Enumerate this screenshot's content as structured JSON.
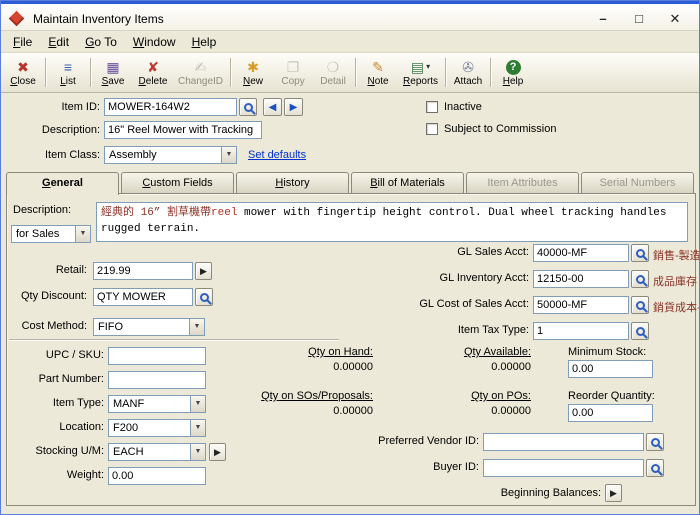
{
  "window": {
    "title": "Maintain Inventory Items"
  },
  "titlebar_controls": {
    "minimize": "–",
    "maximize": "□",
    "close": "✕"
  },
  "menu": {
    "items": [
      "File",
      "Edit",
      "Go To",
      "Window",
      "Help"
    ]
  },
  "toolbar": {
    "buttons": [
      {
        "label": "Close",
        "glyph": "✖"
      },
      {
        "label": "List",
        "glyph": "≡"
      },
      {
        "label": "Save",
        "glyph": "▦"
      },
      {
        "label": "Delete",
        "glyph": "✘"
      },
      {
        "label": "ChangeID",
        "glyph": "✍",
        "disabled": true
      },
      {
        "label": "New",
        "glyph": "✱"
      },
      {
        "label": "Copy",
        "glyph": "❐",
        "disabled": true
      },
      {
        "label": "Detail",
        "glyph": "❍",
        "disabled": true
      },
      {
        "label": "Note",
        "glyph": "✎"
      },
      {
        "label": "Reports",
        "glyph": "▤",
        "caret": "▾"
      },
      {
        "label": "Attach",
        "glyph": "✇"
      },
      {
        "label": "Help",
        "glyph": "?"
      }
    ]
  },
  "header": {
    "item_id_label": "Item ID:",
    "item_id_value": "MOWER-164W2",
    "description_label": "Description:",
    "description_value": "16\" Reel Mower with Tracking",
    "item_class_label": "Item Class:",
    "item_class_value": "Assembly",
    "set_defaults_link": "Set defaults",
    "inactive_label": "Inactive",
    "subject_label": "Subject to Commission",
    "nav_prev_icon": "◀",
    "nav_next_icon": "▶"
  },
  "tabs": {
    "items": [
      {
        "label": "General"
      },
      {
        "label": "Custom Fields"
      },
      {
        "label": "History"
      },
      {
        "label": "Bill of Materials"
      },
      {
        "label": "Item Attributes"
      },
      {
        "label": "Serial Numbers"
      }
    ]
  },
  "general": {
    "description_label": "Description:",
    "description_mode": "for Sales",
    "description_line1_cjk": "經典的 16” 割草機帶",
    "description_line1_red": "reel",
    "description_line1_rest": " mower with fingertip height control.  Dual wheel tracking handles",
    "description_line2": "rugged terrain.",
    "retail_label": "Retail:",
    "retail_value": "219.99",
    "qty_discount_label": "Qty Discount:",
    "qty_discount_value": "QTY MOWER",
    "cost_method_label": "Cost Method:",
    "cost_method_value": "FIFO",
    "gl_sales_label": "GL Sales Acct:",
    "gl_sales_value": "40000-MF",
    "gl_sales_desc": "銷售-製造",
    "gl_inventory_label": "GL Inventory Acct:",
    "gl_inventory_value": "12150-00",
    "gl_inventory_desc": "成品庫存",
    "gl_cos_label": "GL Cost of Sales Acct:",
    "gl_cos_value": "50000-MF",
    "gl_cos_desc": "銷貨成本-製造",
    "item_tax_label": "Item Tax Type:",
    "item_tax_value": "1",
    "upc_label": "UPC / SKU:",
    "upc_value": "",
    "part_number_label": "Part Number:",
    "part_number_value": "",
    "item_type_label": "Item Type:",
    "item_type_value": "MANF",
    "location_label": "Location:",
    "location_value": "F200",
    "stocking_um_label": "Stocking U/M:",
    "stocking_um_value": "EACH",
    "weight_label": "Weight:",
    "weight_value": "0.00",
    "qty_on_hand_label": "Qty on Hand:",
    "qty_on_hand_value": "0.00000",
    "qty_available_label": "Qty Available:",
    "qty_available_value": "0.00000",
    "min_stock_label": "Minimum Stock:",
    "min_stock_value": "0.00",
    "qty_sos_label": "Qty on SOs/Proposals:",
    "qty_sos_value": "0.00000",
    "qty_pos_label": "Qty on POs:",
    "qty_pos_value": "0.00000",
    "reorder_label": "Reorder Quantity:",
    "reorder_value": "0.00",
    "vendor_label": "Preferred Vendor ID:",
    "vendor_value": "",
    "buyer_label": "Buyer ID:",
    "buyer_value": "",
    "beginning_label": "Beginning Balances:"
  },
  "icons": {
    "magnifier": "css-circle-handle",
    "dropdown_arrow": "▼",
    "row_arrow": "▶"
  },
  "colors": {
    "accent_blue": "#2b5cd9",
    "link_blue": "#0033cc",
    "maroon_text": "#8b3226",
    "red_text": "#b03020",
    "disabled_text": "#8f8c7d",
    "window_bg": "#ece9d8"
  }
}
